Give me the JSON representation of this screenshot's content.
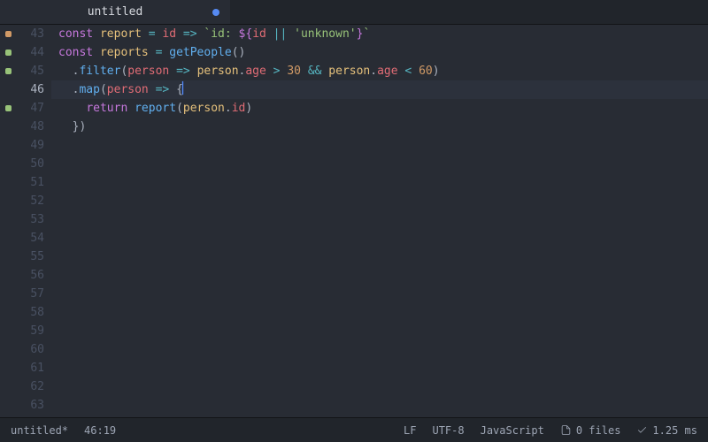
{
  "tab": {
    "title": "untitled",
    "modified": true
  },
  "gutter": {
    "start": 43,
    "end": 63,
    "current": 46
  },
  "markers": {
    "43": "y",
    "44": "g",
    "45": "g",
    "47": "g"
  },
  "code": {
    "l43": {
      "kw": "const",
      "name": "report",
      "eq": "=",
      "param": "id",
      "arrow": "=>",
      "bt": "`",
      "lit1": "id: ",
      "o": "${",
      "id": "id",
      "or": "||",
      "str": "'unknown'",
      "c": "}",
      "bt2": "`"
    },
    "l44": {
      "kw": "const",
      "name": "reports",
      "eq": "=",
      "fn": "getPeople",
      "par": "()"
    },
    "l45": {
      "dot": ".",
      "fn": "filter",
      "lp": "(",
      "param": "person",
      "arrow": "=>",
      "obj1": "person",
      "d1": ".",
      "p1": "age",
      "gt": ">",
      "n1": "30",
      "and": "&&",
      "obj2": "person",
      "d2": ".",
      "p2": "age",
      "lt": "<",
      "n2": "60",
      "rp": ")"
    },
    "l46": {
      "dot": ".",
      "fn": "map",
      "lp": "(",
      "param": "person",
      "arrow": "=>",
      "brace": "{"
    },
    "l47": {
      "kw": "return",
      "fn": "report",
      "lp": "(",
      "obj": "person",
      "d": ".",
      "p": "id",
      "rp": ")"
    },
    "l48": {
      "close": "})"
    }
  },
  "status": {
    "file": "untitled*",
    "pos": "46:19",
    "eol": "LF",
    "encoding": "UTF-8",
    "language": "JavaScript",
    "files": "0 files",
    "timing": "1.25 ms"
  }
}
